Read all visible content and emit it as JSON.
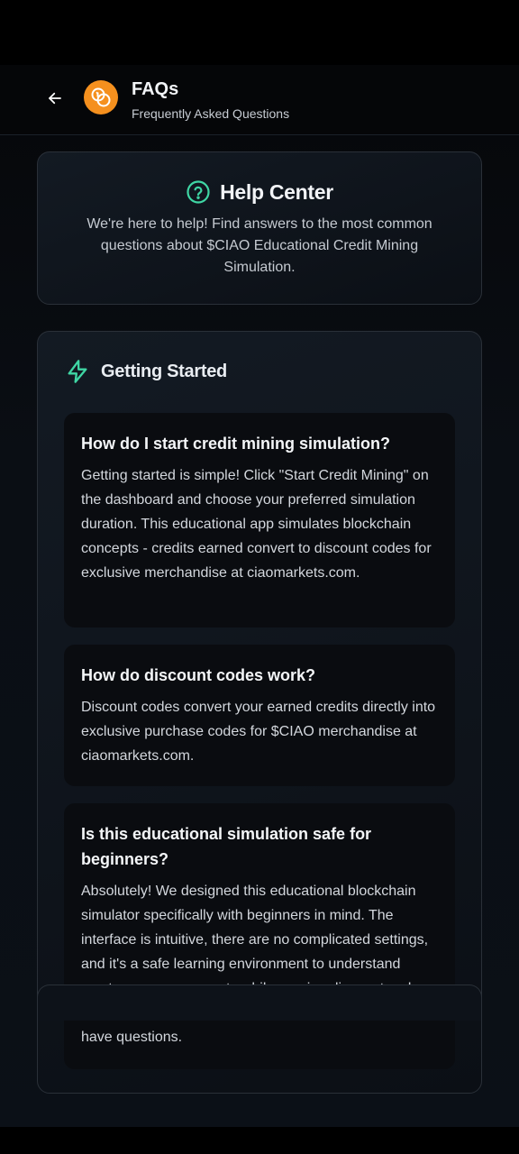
{
  "header": {
    "title": "FAQs",
    "subtitle": "Frequently Asked Questions"
  },
  "help_center": {
    "title": "Help Center",
    "description": "We're here to help! Find answers to the most common questions about $CIAO Educational Credit Mining Simulation."
  },
  "section": {
    "title": "Getting Started",
    "faqs": [
      {
        "question": "How do I start credit mining simulation?",
        "answer": "Getting started is simple! Click \"Start Credit Mining\" on the dashboard and choose your preferred simulation duration. This educational app simulates blockchain concepts - credits earned convert to discount codes for exclusive merchandise at ciaomarkets.com."
      },
      {
        "question": "How do discount codes work?",
        "answer": "Discount codes convert your earned credits directly into exclusive purchase codes for $CIAO merchandise at ciaomarkets.com."
      },
      {
        "question": "Is this educational simulation safe for beginners?",
        "answer": "Absolutely! We designed this educational blockchain simulator specifically with beginners in mind. The interface is intuitive, there are no complicated settings, and it's a safe learning environment to understand cryptocurrency concepts while earning discount codes. Plus, our support team is always here to help if you have questions."
      }
    ]
  },
  "colors": {
    "accent": "#3fd6a4",
    "logo": "#f5901e",
    "background": "#07090d"
  },
  "icons": {
    "back": "arrow-left-icon",
    "logo": "coins-icon",
    "help": "question-circle-icon",
    "section": "lightning-icon"
  }
}
